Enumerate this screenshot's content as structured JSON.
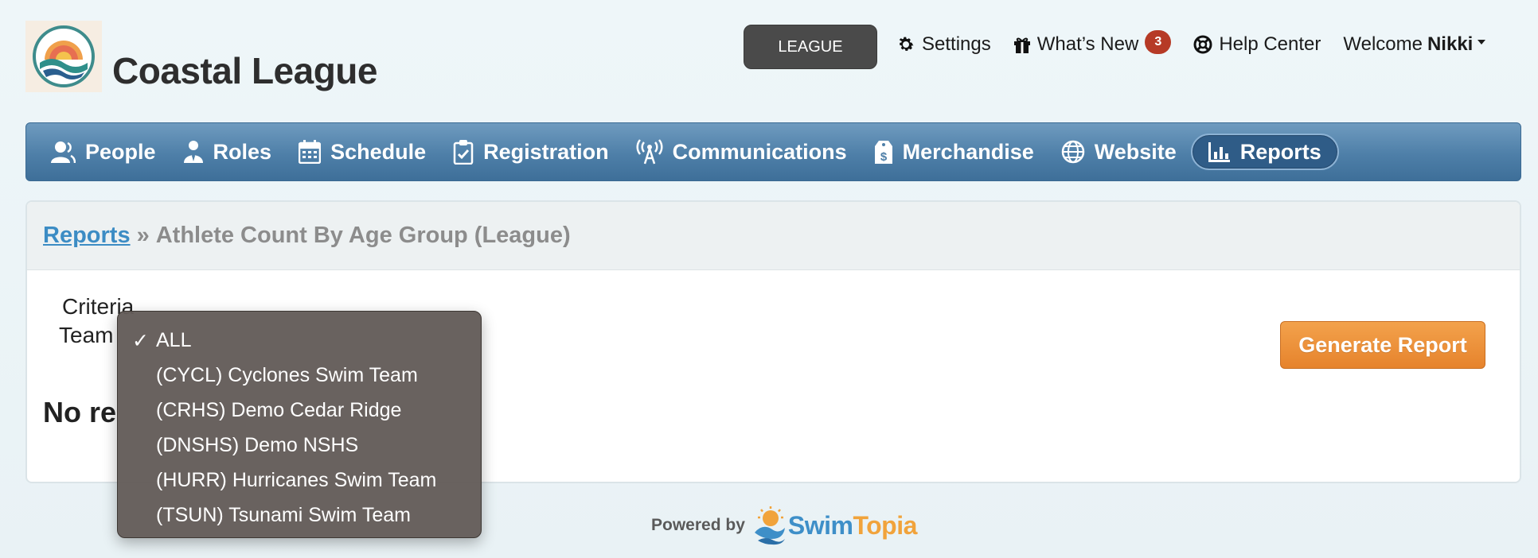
{
  "brand": {
    "title": "Coastal League"
  },
  "header": {
    "league_button": "LEAGUE",
    "settings": "Settings",
    "whats_new": "What’s New",
    "whats_new_count": "3",
    "help_center": "Help Center",
    "welcome_prefix": "Welcome",
    "user_name": "Nikki"
  },
  "nav": {
    "items": [
      {
        "label": "People",
        "icon": "people-icon"
      },
      {
        "label": "Roles",
        "icon": "roles-icon"
      },
      {
        "label": "Schedule",
        "icon": "calendar-icon"
      },
      {
        "label": "Registration",
        "icon": "clipboard-check-icon"
      },
      {
        "label": "Communications",
        "icon": "antenna-icon"
      },
      {
        "label": "Merchandise",
        "icon": "price-tag-icon"
      },
      {
        "label": "Website",
        "icon": "globe-icon"
      },
      {
        "label": "Reports",
        "icon": "bar-chart-icon",
        "active": true
      }
    ]
  },
  "breadcrumb": {
    "link": "Reports",
    "separator": "»",
    "current": "Athlete Count By Age Group (League)"
  },
  "criteria": {
    "heading": "Criteria",
    "team_label": "Team",
    "selected": "ALL",
    "options": [
      "ALL",
      "(CYCL) Cyclones Swim Team",
      "(CRHS) Demo Cedar Ridge",
      "(DNSHS) Demo NSHS",
      "(HURR) Hurricanes Swim Team",
      "(TSUN) Tsunami Swim Team"
    ]
  },
  "results": {
    "empty_text": "No re"
  },
  "actions": {
    "generate_report": "Generate Report"
  },
  "footer": {
    "powered_by": "Powered by",
    "logo_part1": "Swim",
    "logo_part2": "Topia"
  },
  "colors": {
    "nav_bar": "#4e7fa8",
    "active_nav": "#2f5c87",
    "badge": "#b63a26",
    "generate_button": "#e6832c",
    "link": "#3c8cc4",
    "dropdown_bg": "#635c58"
  }
}
